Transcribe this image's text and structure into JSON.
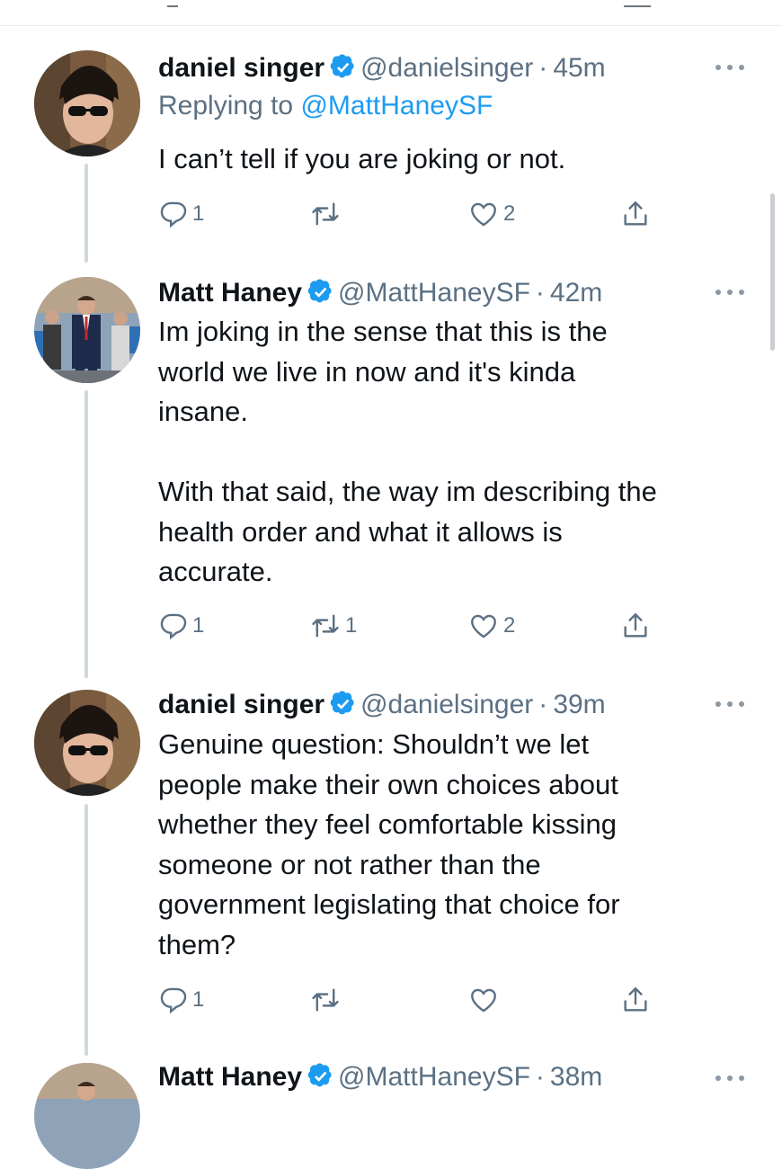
{
  "tweets": [
    {
      "name": "daniel singer",
      "handle": "@danielsinger",
      "separator": "·",
      "time": "45m",
      "replying_prefix": "Replying to ",
      "replying_to": "@MattHaneySF",
      "text": "I can’t tell if you are joking or not.",
      "replies": "1",
      "retweets": "",
      "likes": "2"
    },
    {
      "name": "Matt Haney",
      "handle": "@MattHaneySF",
      "separator": "·",
      "time": "42m",
      "text": "Im joking in the sense that this is the\nworld we live in now and it's kinda\ninsane.\n\nWith that said, the way im describing the\nhealth order and what it allows is\naccurate.",
      "replies": "1",
      "retweets": "1",
      "likes": "2"
    },
    {
      "name": "daniel singer",
      "handle": "@danielsinger",
      "separator": "·",
      "time": "39m",
      "text": "Genuine question: Shouldn’t we let\npeople make their own choices about\nwhether they feel comfortable kissing\nsomeone or not rather than the\ngovernment legislating that choice for\nthem?",
      "replies": "1",
      "retweets": "",
      "likes": ""
    },
    {
      "name": "Matt Haney",
      "handle": "@MattHaneySF",
      "separator": "·",
      "time": "38m"
    }
  ],
  "colors": {
    "text": "#0f1419",
    "secondary": "#5b7083",
    "link": "#1d9bf0",
    "verified": "#1d9bf0",
    "thread_line": "#cfd9de"
  },
  "icons": [
    "verified-badge-icon",
    "more-options-icon",
    "reply-icon",
    "retweet-icon",
    "like-icon",
    "share-icon"
  ]
}
